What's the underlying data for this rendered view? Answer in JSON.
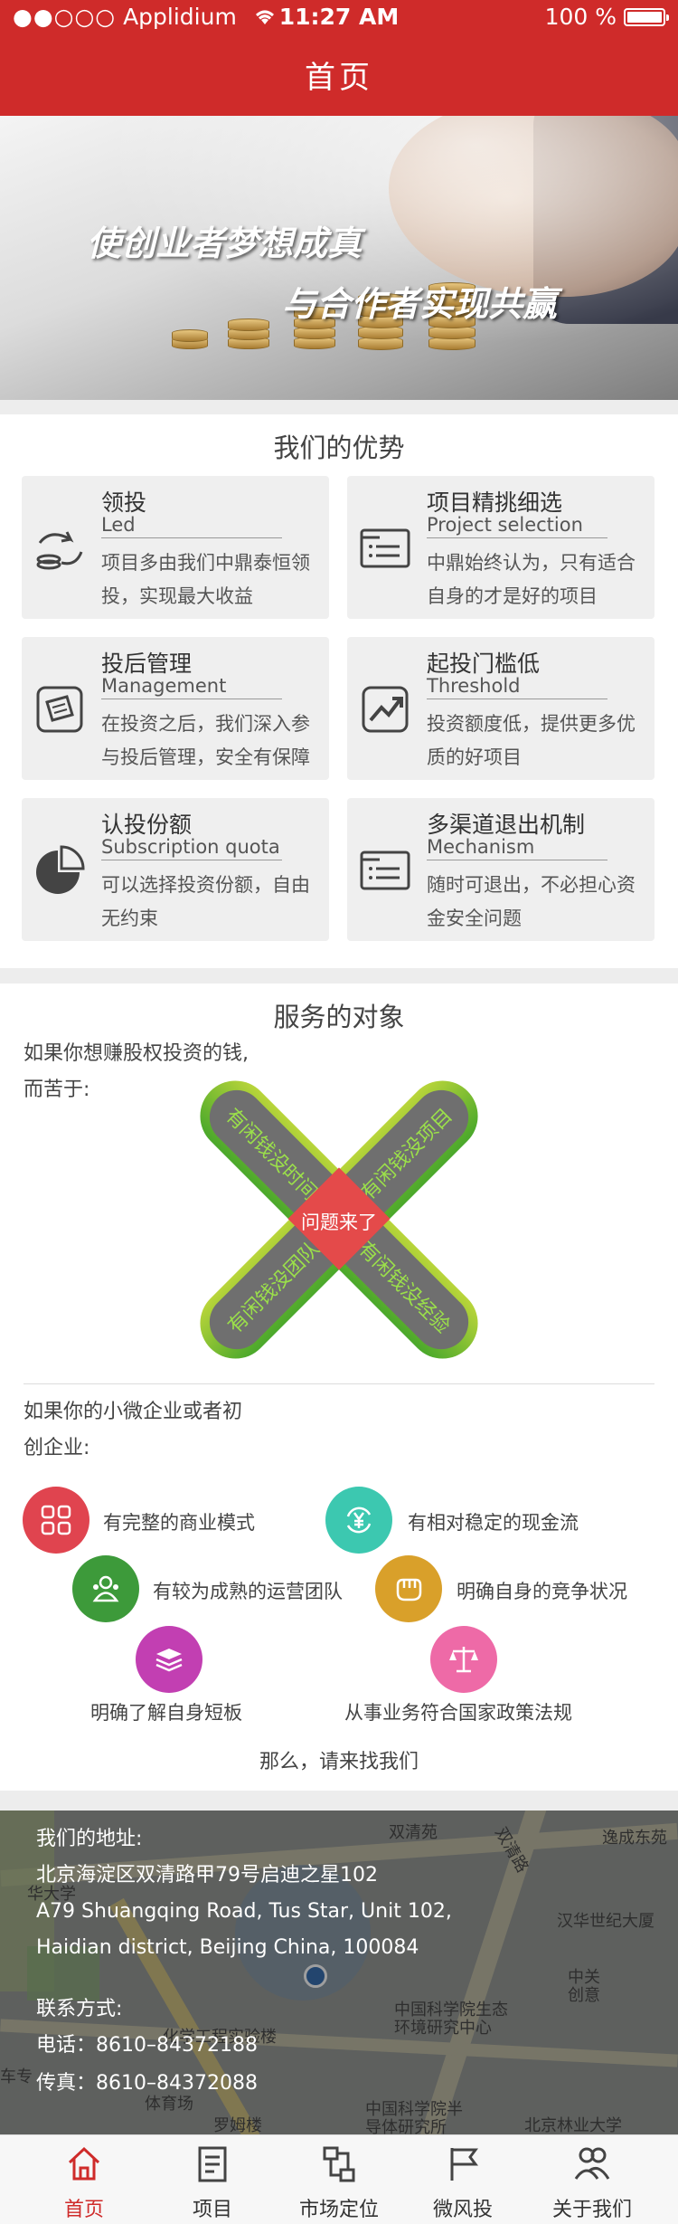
{
  "status_bar": {
    "carrier_dots": "●●○○○",
    "carrier": "Applidium",
    "time": "11:27 AM",
    "battery": "100 %"
  },
  "header": {
    "title": "首页"
  },
  "banner": {
    "line1": "使创业者梦想成真",
    "line2": "与合作者实现共赢"
  },
  "advantages": {
    "title": "我们的优势",
    "cards": [
      {
        "title": "领投",
        "subtitle": "Led",
        "desc": "项目多由我们中鼎泰恒领投，实现最大收益",
        "icon": "coins-hand-icon"
      },
      {
        "title": "项目精挑细选",
        "subtitle": "Project selection",
        "desc": "中鼎始终认为，只有适合自身的才是好的项目",
        "icon": "list-card-icon"
      },
      {
        "title": "投后管理",
        "subtitle": "Management",
        "desc": "在投资之后，我们深入参与投后管理，安全有保障",
        "icon": "clipboard-icon"
      },
      {
        "title": "起投门槛低",
        "subtitle": "Threshold",
        "desc": "投资额度低，提供更多优质的好项目",
        "icon": "trend-chart-icon"
      },
      {
        "title": "认投份额",
        "subtitle": "Subscription quota",
        "desc": "可以选择投资份额，自由无约束",
        "icon": "pie-chart-icon"
      },
      {
        "title": "多渠道退出机制",
        "subtitle": "Mechanism",
        "desc": "随时可退出，不必担心资金安全问题",
        "icon": "list-card-icon"
      }
    ]
  },
  "service": {
    "title": "服务的对象",
    "intro_line1": "如果你想赚股权投资的钱,",
    "intro_line2": "而苦于:",
    "cross": {
      "center": "问题来了",
      "top_left": "有闲钱没时间",
      "top_right": "有闲钱没项目",
      "bottom_left": "有闲钱没团队",
      "bottom_right": "有闲钱没经验"
    },
    "intro2_line1": "如果你的小微企业或者初",
    "intro2_line2": "创企业:",
    "items": [
      {
        "label": "有完整的商业模式",
        "color": "#e0444f",
        "icon": "grid-icon"
      },
      {
        "label": "有相对稳定的现金流",
        "color": "#3cc8b0",
        "icon": "yuan-cycle-icon"
      },
      {
        "label": "有较为成熟的运营团队",
        "color": "#3d9a3a",
        "icon": "team-icon"
      },
      {
        "label": "明确自身的竞争状况",
        "color": "#d9a02a",
        "icon": "fist-icon"
      },
      {
        "label": "明确了解自身短板",
        "color": "#c23fb2",
        "icon": "layers-icon"
      },
      {
        "label": "从事业务符合国家政策法规",
        "color": "#ee6aa7",
        "icon": "scales-icon"
      }
    ],
    "closing": "那么，请来找我们"
  },
  "contact": {
    "address_label": "我们的地址:",
    "address_cn": "北京海淀区双清路甲79号启迪之星102",
    "address_en1": "A79 Shuangqing Road, Tus Star, Unit 102,",
    "address_en2": "Haidian district, Beijing China, 100084",
    "contact_label": "联系方式:",
    "phone": "电话：8610–84372188",
    "fax": "传真：8610–84372088",
    "map_labels": [
      "双清苑",
      "双清路",
      "逸成东苑",
      "华大学",
      "汉华世纪大厦",
      "中关",
      "创意",
      "中国科学院生态",
      "环境研究中心",
      "化学工程实验楼",
      "车专",
      "体育场",
      "罗姆楼",
      "中国科学院半",
      "导体研究所",
      "北京林业大学"
    ]
  },
  "tabbar": {
    "items": [
      {
        "label": "首页",
        "icon": "home-icon",
        "active": true
      },
      {
        "label": "项目",
        "icon": "document-icon",
        "active": false
      },
      {
        "label": "市场定位",
        "icon": "flow-icon",
        "active": false
      },
      {
        "label": "微风投",
        "icon": "flag-icon",
        "active": false
      },
      {
        "label": "关于我们",
        "icon": "people-icon",
        "active": false
      }
    ]
  }
}
